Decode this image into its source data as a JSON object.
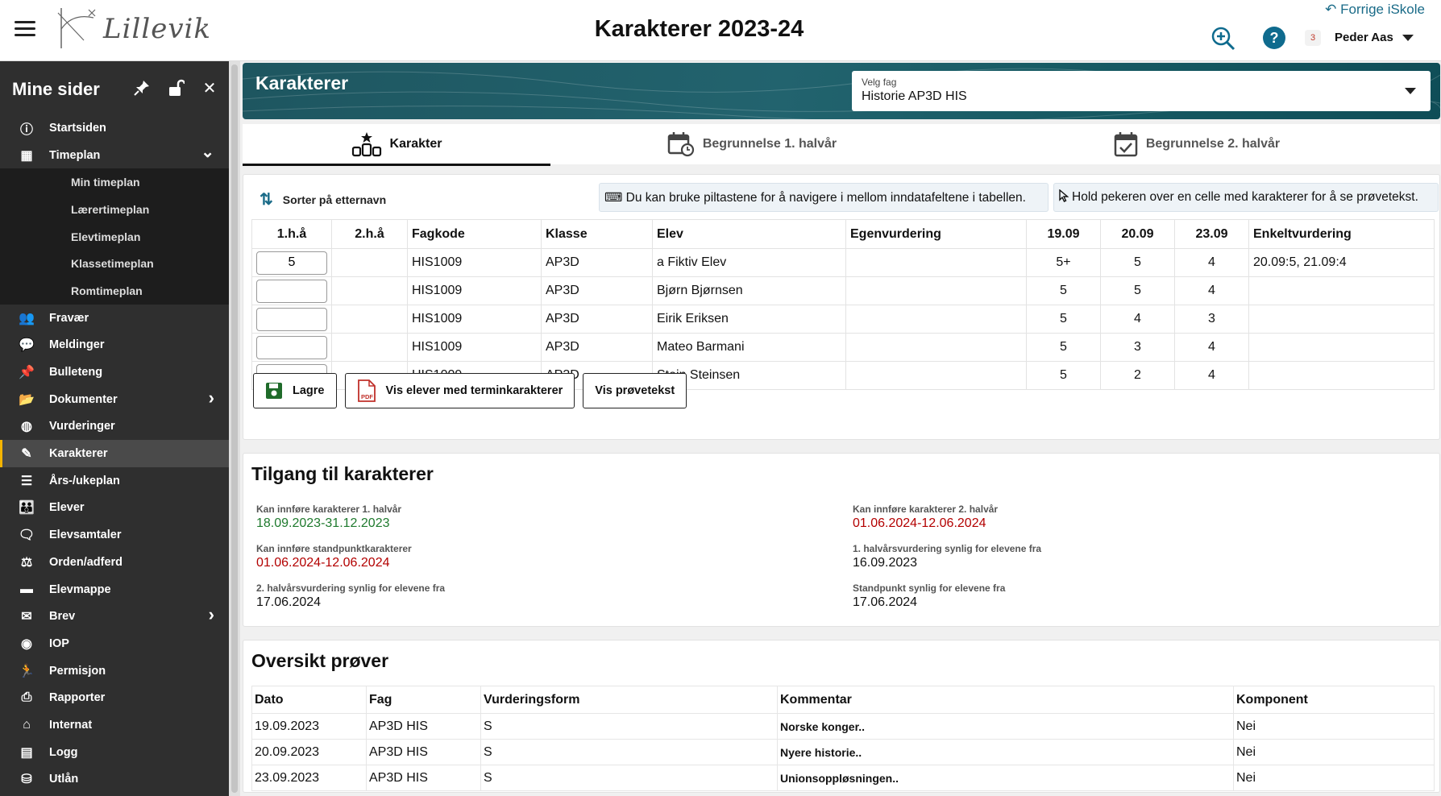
{
  "header": {
    "title": "Karakterer 2023-24",
    "logo_text": "Lillevik",
    "back_link": "Forrige iSkole",
    "notification_count": "3",
    "user_name": "Peder Aas"
  },
  "sidebar": {
    "title": "Mine sider",
    "items": [
      {
        "label": "Startsiden",
        "icon": "info-icon"
      },
      {
        "label": "Timeplan",
        "icon": "calendar-icon",
        "expanded": true
      },
      {
        "label": "Fravær",
        "icon": "people-icon"
      },
      {
        "label": "Meldinger",
        "icon": "chat-icon"
      },
      {
        "label": "Bulleteng",
        "icon": "pin-icon"
      },
      {
        "label": "Dokumenter",
        "icon": "folder-open-icon"
      },
      {
        "label": "Vurderinger",
        "icon": "palette-icon"
      },
      {
        "label": "Karakterer",
        "icon": "edit-icon",
        "active": true
      },
      {
        "label": "Års-/ukeplan",
        "icon": "list-icon"
      },
      {
        "label": "Elever",
        "icon": "group-icon"
      },
      {
        "label": "Elevsamtaler",
        "icon": "comment-icon"
      },
      {
        "label": "Orden/adferd",
        "icon": "scale-icon"
      },
      {
        "label": "Elevmappe",
        "icon": "folder-icon"
      },
      {
        "label": "Brev",
        "icon": "mail-icon"
      },
      {
        "label": "IOP",
        "icon": "iop-icon"
      },
      {
        "label": "Permisjon",
        "icon": "permission-icon"
      },
      {
        "label": "Rapporter",
        "icon": "printer-icon"
      },
      {
        "label": "Internat",
        "icon": "home-user-icon"
      },
      {
        "label": "Logg",
        "icon": "log-icon"
      },
      {
        "label": "Utlån",
        "icon": "basket-icon"
      }
    ],
    "timeplan_sub": [
      "Min timeplan",
      "Lærertimeplan",
      "Elevtimeplan",
      "Klassetimeplan",
      "Romtimeplan"
    ]
  },
  "banner": {
    "title": "Karakterer",
    "select_label": "Velg fag",
    "select_value": "Historie AP3D HIS"
  },
  "tabs": [
    {
      "label": "Karakter",
      "active": true
    },
    {
      "label": "Begrunnelse 1. halvår"
    },
    {
      "label": "Begrunnelse 2. halvår"
    }
  ],
  "grades": {
    "sort_label": "Sorter på etternavn",
    "hint_keyboard": "⌨ Du kan bruke piltastene for å navigere i mellom inndatafeltene i tabellen.",
    "hint_hover": "Hold pekeren over en celle med karakterer for å se prøvetekst.",
    "columns": [
      "1.h.å",
      "2.h.å",
      "Fagkode",
      "Klasse",
      "Elev",
      "Egenvurdering",
      "19.09",
      "20.09",
      "23.09",
      "Enkeltvurdering"
    ],
    "rows": [
      {
        "h1": "5",
        "h2": "",
        "fagkode": "HIS1009",
        "klasse": "AP3D",
        "elev": "a Fiktiv Elev",
        "egen": "",
        "d1": "5+",
        "d2": "5",
        "d3": "4",
        "enkelt": "20.09:5, 21.09:4"
      },
      {
        "h1": "",
        "h2": "",
        "fagkode": "HIS1009",
        "klasse": "AP3D",
        "elev": "Bjørn Bjørnsen",
        "egen": "",
        "d1": "5",
        "d2": "5",
        "d3": "4",
        "enkelt": ""
      },
      {
        "h1": "",
        "h2": "",
        "fagkode": "HIS1009",
        "klasse": "AP3D",
        "elev": "Eirik Eriksen",
        "egen": "",
        "d1": "5",
        "d2": "4",
        "d3": "3",
        "enkelt": ""
      },
      {
        "h1": "",
        "h2": "",
        "fagkode": "HIS1009",
        "klasse": "AP3D",
        "elev": "Mateo Barmani",
        "egen": "",
        "d1": "5",
        "d2": "3",
        "d3": "4",
        "enkelt": ""
      },
      {
        "h1": "",
        "h2": "",
        "fagkode": "HIS1009",
        "klasse": "AP3D",
        "elev": "Stein Steinsen",
        "egen": "",
        "d1": "5",
        "d2": "2",
        "d3": "4",
        "enkelt": ""
      }
    ],
    "btn_save": "Lagre",
    "btn_term": "Vis elever med terminkarakterer",
    "btn_test": "Vis prøvetekst"
  },
  "access": {
    "title": "Tilgang til karakterer",
    "fields": [
      {
        "label": "Kan innføre karakterer 1. halvår",
        "value": "18.09.2023-31.12.2023",
        "color": "#1f7a2e"
      },
      {
        "label": "Kan innføre standpunktkarakterer",
        "value": "01.06.2024-12.06.2024",
        "color": "#b30000"
      },
      {
        "label": "2. halvårsvurdering synlig for elevene fra",
        "value": "17.06.2024",
        "color": "#111111"
      },
      {
        "label": "Kan innføre karakterer 2. halvår",
        "value": "01.06.2024-12.06.2024",
        "color": "#b30000"
      },
      {
        "label": "1. halvårsvurdering synlig for elevene fra",
        "value": "16.09.2023",
        "color": "#111111"
      },
      {
        "label": "Standpunkt synlig for elevene fra",
        "value": "17.06.2024",
        "color": "#111111"
      }
    ]
  },
  "tests": {
    "title": "Oversikt prøver",
    "columns": [
      "Dato",
      "Fag",
      "Vurderingsform",
      "Kommentar",
      "Komponent"
    ],
    "rows": [
      {
        "dato": "19.09.2023",
        "fag": "AP3D HIS",
        "form": "S",
        "kommentar": "Norske konger..",
        "komponent": "Nei"
      },
      {
        "dato": "20.09.2023",
        "fag": "AP3D HIS",
        "form": "S",
        "kommentar": "Nyere historie..",
        "komponent": "Nei"
      },
      {
        "dato": "23.09.2023",
        "fag": "AP3D HIS",
        "form": "S",
        "kommentar": "Unionsoppløsningen..",
        "komponent": "Nei"
      }
    ]
  }
}
